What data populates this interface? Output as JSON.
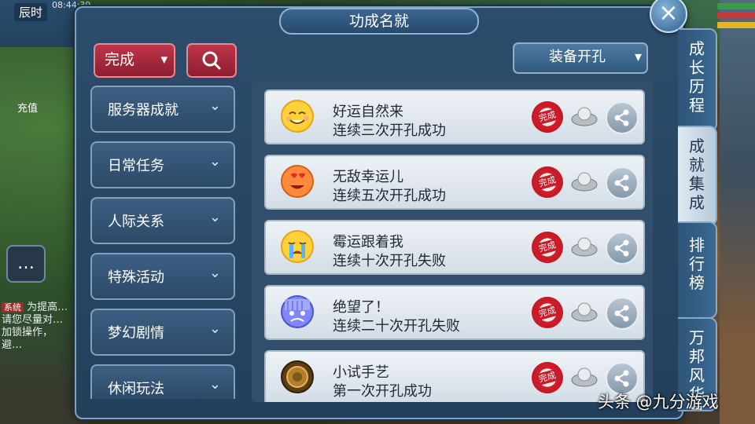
{
  "hud": {
    "time_label": "辰时",
    "clock": "08:44:39",
    "recharge_label": "充值",
    "system_tag": "系统",
    "system_msg": "为提高…请您尽量对…加锁操作，避…"
  },
  "panel": {
    "title": "功成名就",
    "close_icon": "×"
  },
  "filters": {
    "status_label": "完成",
    "status_chevron": "▾",
    "equip_label": "装备开孔",
    "equip_chevron": "▾"
  },
  "categories": [
    {
      "label": "服务器成就"
    },
    {
      "label": "日常任务"
    },
    {
      "label": "人际关系"
    },
    {
      "label": "特殊活动"
    },
    {
      "label": "梦幻剧情"
    },
    {
      "label": "休闲玩法"
    }
  ],
  "achievements": [
    {
      "name": "好运自然来",
      "desc": "连续三次开孔成功",
      "emoji": "smile-emoji",
      "stamp": "完成"
    },
    {
      "name": "无敌幸运儿",
      "desc": "连续五次开孔成功",
      "emoji": "love-eyes-emoji",
      "stamp": "完成"
    },
    {
      "name": "霉运跟着我",
      "desc": "连续十次开孔失败",
      "emoji": "crying-emoji",
      "stamp": "完成"
    },
    {
      "name": "绝望了！",
      "desc": "连续二十次开孔失败",
      "emoji": "despair-emoji",
      "stamp": "完成"
    },
    {
      "name": "小试手艺",
      "desc": "第一次开孔成功",
      "emoji": "bronze-medal",
      "stamp": "完成"
    }
  ],
  "tabs": [
    {
      "label": "成长历程"
    },
    {
      "label": "成就集成"
    },
    {
      "label": "排行榜"
    },
    {
      "label": "万邦风华录"
    }
  ],
  "watermark": "头条 @九分游戏",
  "colors": {
    "panel_bg": "#264563",
    "filter_red": "#a8283b",
    "seal_red": "#c61b28"
  }
}
